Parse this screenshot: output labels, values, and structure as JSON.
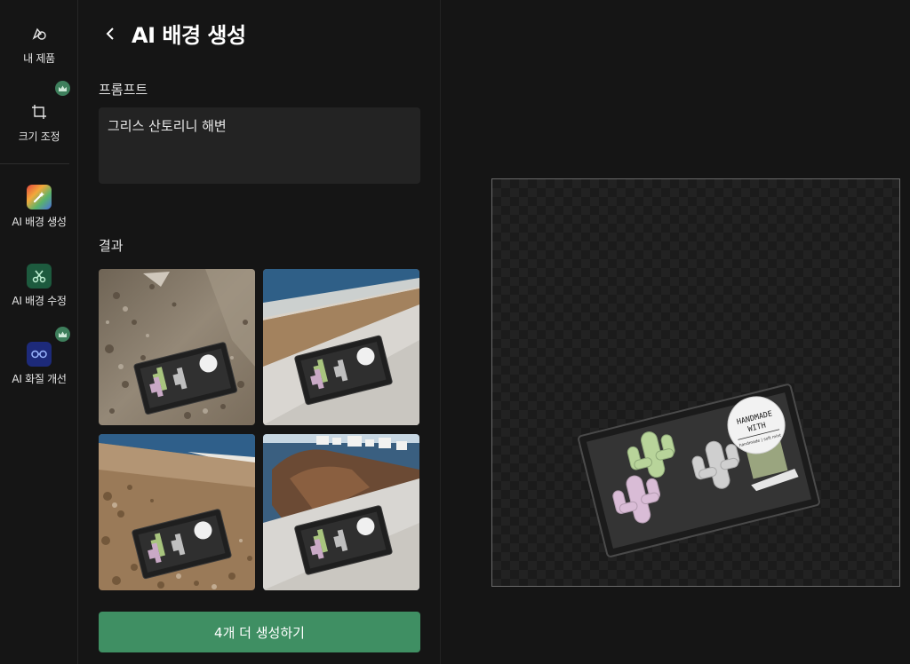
{
  "rail": {
    "my_products": "내 제품",
    "resize": "크기 조정",
    "ai_bg_generate": "AI 배경 생성",
    "ai_bg_edit": "AI 배경 수정",
    "ai_enhance": "AI 화질 개선"
  },
  "header": {
    "title": "AI 배경 생성"
  },
  "prompt": {
    "label": "프롬프트",
    "value": "그리스 산토리니 해변"
  },
  "results": {
    "label": "결과"
  },
  "actions": {
    "generate_more": "4개 더 생성하기"
  },
  "product": {
    "sticker_line1": "HANDMADE",
    "sticker_line2": "WITH",
    "sticker_small": "handmade | soft mint"
  },
  "colors": {
    "accent": "#3f8f63",
    "crown": "#3e7f5c",
    "background": "#151515"
  }
}
